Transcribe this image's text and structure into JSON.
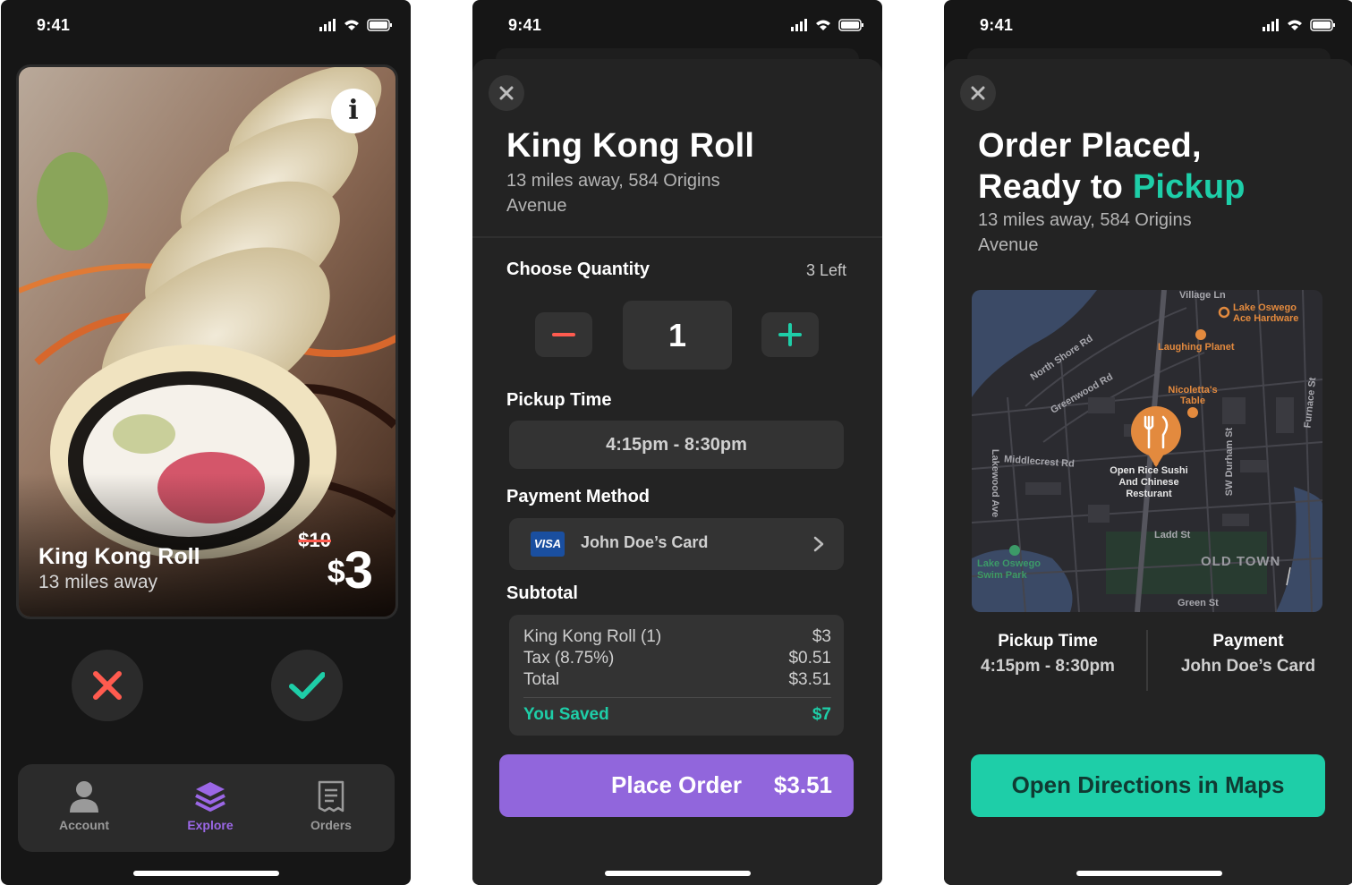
{
  "status": {
    "time": "9:41"
  },
  "swipe": {
    "item_name": "King Kong Roll",
    "distance": "13 miles away",
    "old_price": "$10",
    "currency": "$",
    "price_value": "3"
  },
  "tabs": [
    {
      "label": "Account"
    },
    {
      "label": "Explore"
    },
    {
      "label": "Orders"
    }
  ],
  "order": {
    "title": "King Kong Roll",
    "address": "13 miles away, 584 Origins Avenue",
    "quantity_label": "Choose Quantity",
    "left_count": "3 Left",
    "quantity": "1",
    "pickup_label": "Pickup Time",
    "pickup_time": "4:15pm - 8:30pm",
    "payment_label": "Payment Method",
    "card_brand": "VISA",
    "card_name": "John Doe’s Card",
    "subtotal_label": "Subtotal",
    "lines": [
      {
        "label": "King Kong Roll (1)",
        "amount": "$3"
      },
      {
        "label": "Tax (8.75%)",
        "amount": "$0.51"
      },
      {
        "label": "Total",
        "amount": "$3.51"
      }
    ],
    "saved_label": "You Saved",
    "saved_amount": "$7",
    "cta_label": "Place Order",
    "cta_amount": "$3.51"
  },
  "placed": {
    "title_line1": "Order Placed,",
    "title_line2_prefix": "Ready to ",
    "title_line2_accent": "Pickup",
    "address": "13 miles away, 584 Origins Avenue",
    "map": {
      "streets": [
        "Village Ln",
        "North Shore Rd",
        "Greenwood Rd",
        "Middlecrest Rd",
        "Lakewood Ave",
        "SW Durham St",
        "Furnace St",
        "Ladd St",
        "Green St"
      ],
      "pois": [
        "Lake Oswego Ace Hardware",
        "Laughing Planet",
        "Nicoletta's Table"
      ],
      "park": "Lake Oswego Swim Park",
      "destination": "Open Rice Sushi And Chinese Resturant",
      "area": "OLD TOWN"
    },
    "pickup_label": "Pickup Time",
    "pickup_time": "4:15pm - 8:30pm",
    "payment_label": "Payment",
    "payment_value": "John Doe’s Card",
    "cta_label": "Open Directions in Maps"
  },
  "colors": {
    "accent_teal": "#1ecea8",
    "accent_purple": "#9166dc",
    "reject_red": "#ff5b4f",
    "background": "#161616"
  }
}
